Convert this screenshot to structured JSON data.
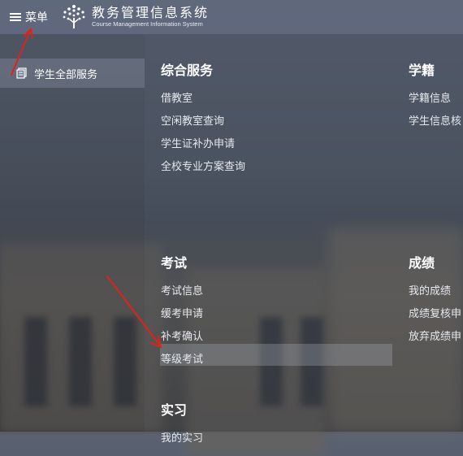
{
  "header": {
    "menu_label": "菜单",
    "title_cn": "教务管理信息系统",
    "title_en": "Course Management Information System"
  },
  "sidebar": {
    "items": [
      {
        "label": "学生全部服务"
      }
    ]
  },
  "groups": {
    "comprehensive": {
      "title": "综合服务",
      "items": [
        "借教室",
        "空闲教室查询",
        "学生证补办申请",
        "全校专业方案查询"
      ]
    },
    "status": {
      "title": "学籍",
      "items": [
        "学籍信息",
        "学生信息核"
      ]
    },
    "exam": {
      "title": "考试",
      "items": [
        "考试信息",
        "缓考申请",
        "补考确认",
        "等级考试"
      ]
    },
    "grades": {
      "title": "成绩",
      "items": [
        "我的成绩",
        "成绩复核申",
        "放弃成绩申"
      ]
    },
    "internship": {
      "title": "实习",
      "items": [
        "我的实习"
      ]
    }
  },
  "annotations": {
    "arrow_color": "#e0221b"
  }
}
